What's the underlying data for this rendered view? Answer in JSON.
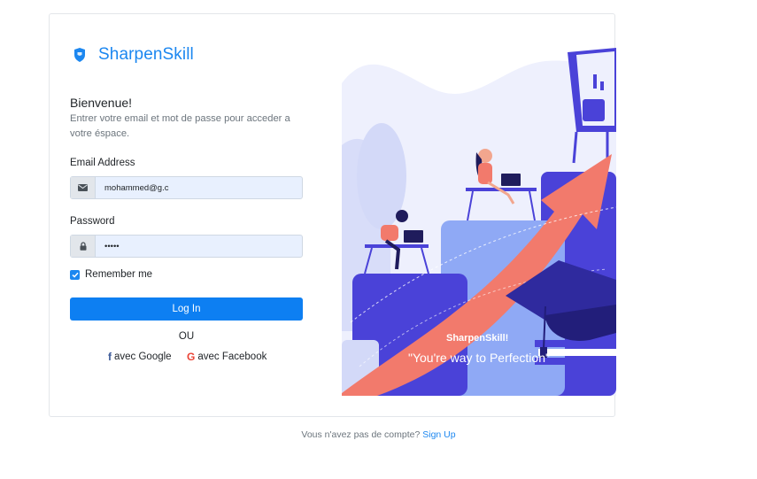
{
  "brand": {
    "name": "SharpenSkill",
    "icon": "shield-icon"
  },
  "welcome": {
    "title": "Bienvenue!",
    "subtitle": "Entrer votre email et mot de passe pour acceder a votre éspace."
  },
  "form": {
    "email_label": "Email Address",
    "email_value": "mohammed@g.c",
    "email_icon": "envelope-icon",
    "password_label": "Password",
    "password_value": "•••••",
    "password_icon": "lock-icon",
    "remember_label": "Remember me",
    "remember_checked": true,
    "login_label": "Log In",
    "or_label": "OU"
  },
  "social": {
    "google_label": "avec Google",
    "facebook_label": "avec Facebook"
  },
  "illustration": {
    "headline": "SharpenSkill!",
    "tagline": "\"You're way to Perfection\""
  },
  "footer": {
    "text": "Vous n'avez pas de compte?",
    "signup_label": "Sign Up"
  },
  "colors": {
    "primary": "#1c87f0",
    "button": "#0d7ff2",
    "illustration_bg": "#eef0fd",
    "arrow": "#f27a6c",
    "indigo": "#4a42d8"
  }
}
